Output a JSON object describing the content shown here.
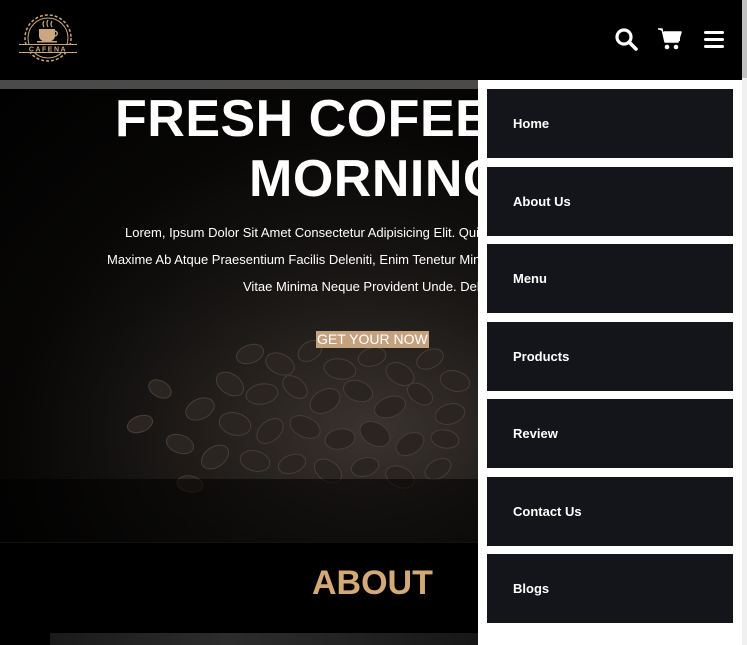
{
  "header": {
    "logo_text": "CAFENA",
    "icons": [
      "search-icon",
      "cart-icon",
      "menu-icon"
    ]
  },
  "hero": {
    "title_line1": "FRESH COFEE IN",
    "title_line2": "MORNING",
    "text_line1": "Lorem, Ipsum Dolor Sit Amet Consectetur Adipisicing Elit. Quia",
    "text_line2": "Maxime Ab Atque Praesentium Facilis Deleniti, Enim Tenetur Minus",
    "text_line3": "Vitae Minima Neque Provident Unde. Debitis",
    "cta_label": "GET YOUR NOW"
  },
  "about": {
    "title": "ABOUT"
  },
  "nav": {
    "items": [
      {
        "label": "Home"
      },
      {
        "label": "About Us"
      },
      {
        "label": "Menu"
      },
      {
        "label": "Products"
      },
      {
        "label": "Review"
      },
      {
        "label": "Contact Us"
      },
      {
        "label": "Blogs"
      }
    ]
  },
  "colors": {
    "accent": "#d3a978",
    "cta_bg": "#c4a27e",
    "nav_item_bg": "#14151b"
  }
}
